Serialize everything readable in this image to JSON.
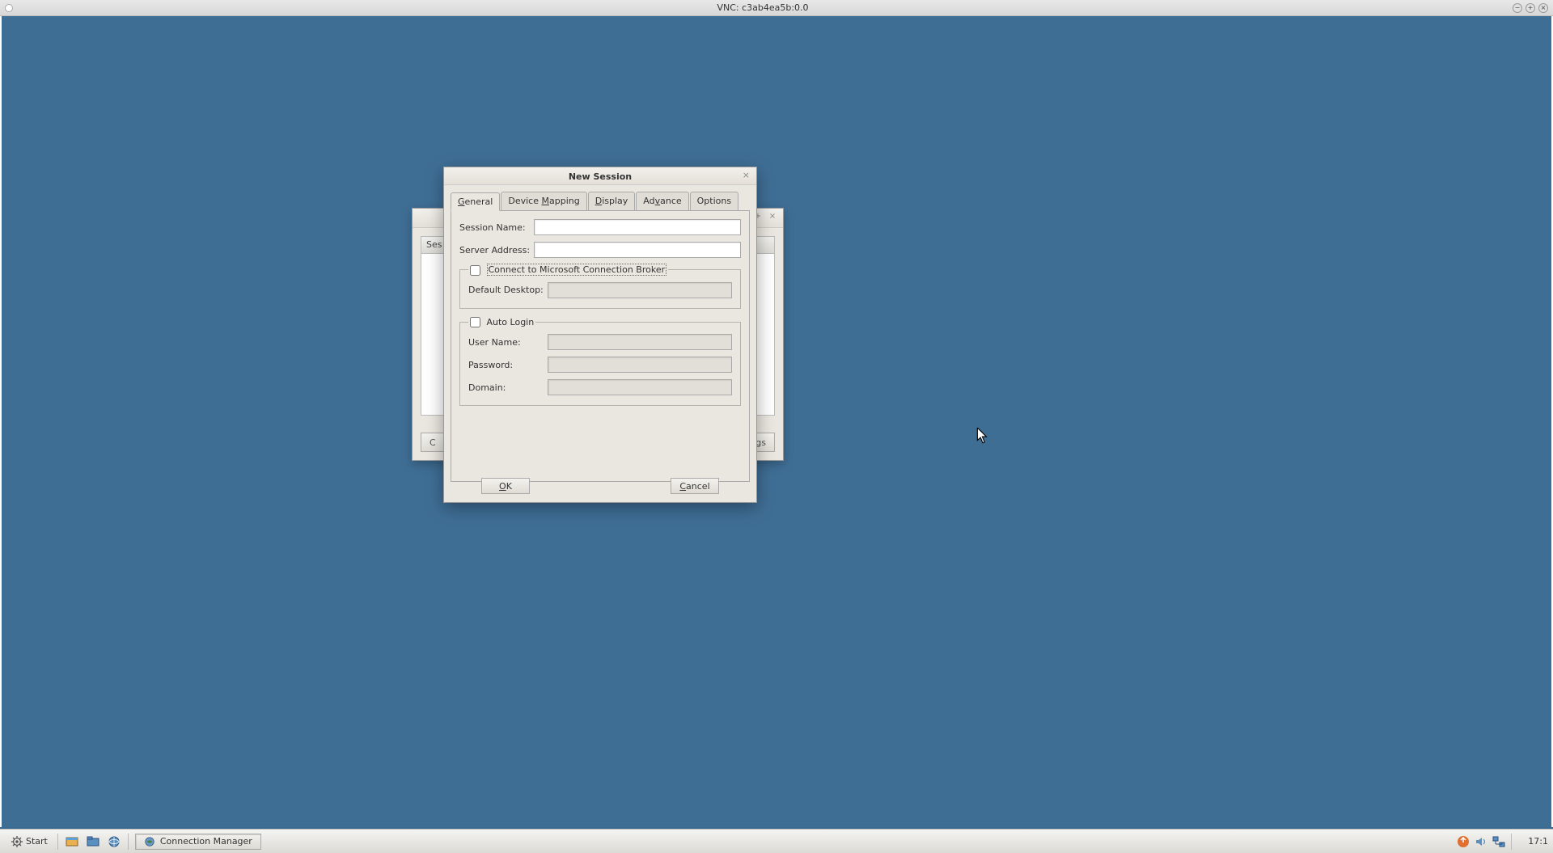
{
  "outer": {
    "title": "VNC: c3ab4ea5b:0.0"
  },
  "bg_window": {
    "list_header": "Ses",
    "btn_left": "C",
    "btn_right": "gs"
  },
  "dialog": {
    "title": "New Session",
    "tabs": {
      "general": "General",
      "device_mapping": "Device Mapping",
      "display": "Display",
      "advance": "Advance",
      "options": "Options"
    },
    "labels": {
      "session_name": "Session Name:",
      "server_address": "Server Address:",
      "broker_legend": "Connect to Microsoft Connection Broker",
      "default_desktop": "Default Desktop:",
      "auto_login_legend": "Auto Login",
      "user_name": "User Name:",
      "password": "Password:",
      "domain": "Domain:"
    },
    "values": {
      "session_name": "",
      "server_address": "",
      "default_desktop": "",
      "user_name": "",
      "password": "",
      "domain": ""
    },
    "buttons": {
      "ok": "OK",
      "cancel": "Cancel"
    }
  },
  "taskbar": {
    "start": "Start",
    "task1": "Connection Manager",
    "clock": "17:1"
  }
}
